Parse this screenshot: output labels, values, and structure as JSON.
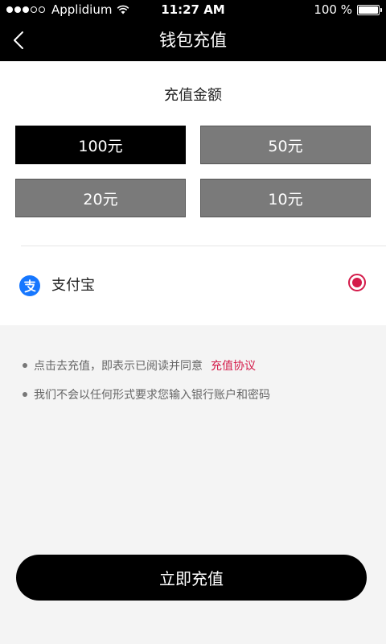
{
  "status_bar": {
    "carrier": "Applidium",
    "time": "11:27 AM",
    "battery": "100 %"
  },
  "nav": {
    "title": "钱包充值",
    "back_icon": "chevron-left-icon"
  },
  "recharge": {
    "title": "充值金额",
    "amounts": [
      {
        "label": "100元",
        "selected": true
      },
      {
        "label": "50元",
        "selected": false
      },
      {
        "label": "20元",
        "selected": false
      },
      {
        "label": "10元",
        "selected": false
      }
    ]
  },
  "payment": {
    "method_label": "支付宝",
    "icon": "alipay-icon",
    "selected": true
  },
  "notes": {
    "line1": "点击去充值，即表示已阅读并同意",
    "agreement_link": "充值协议",
    "line2": "我们不会以任何形式要求您输入银行账户和密码"
  },
  "submit_label": "立即充值",
  "colors": {
    "accent": "#d41b4a",
    "selected_bg": "#000000",
    "unselected_bg": "#7a7a7a",
    "alipay_blue": "#1677ff"
  }
}
